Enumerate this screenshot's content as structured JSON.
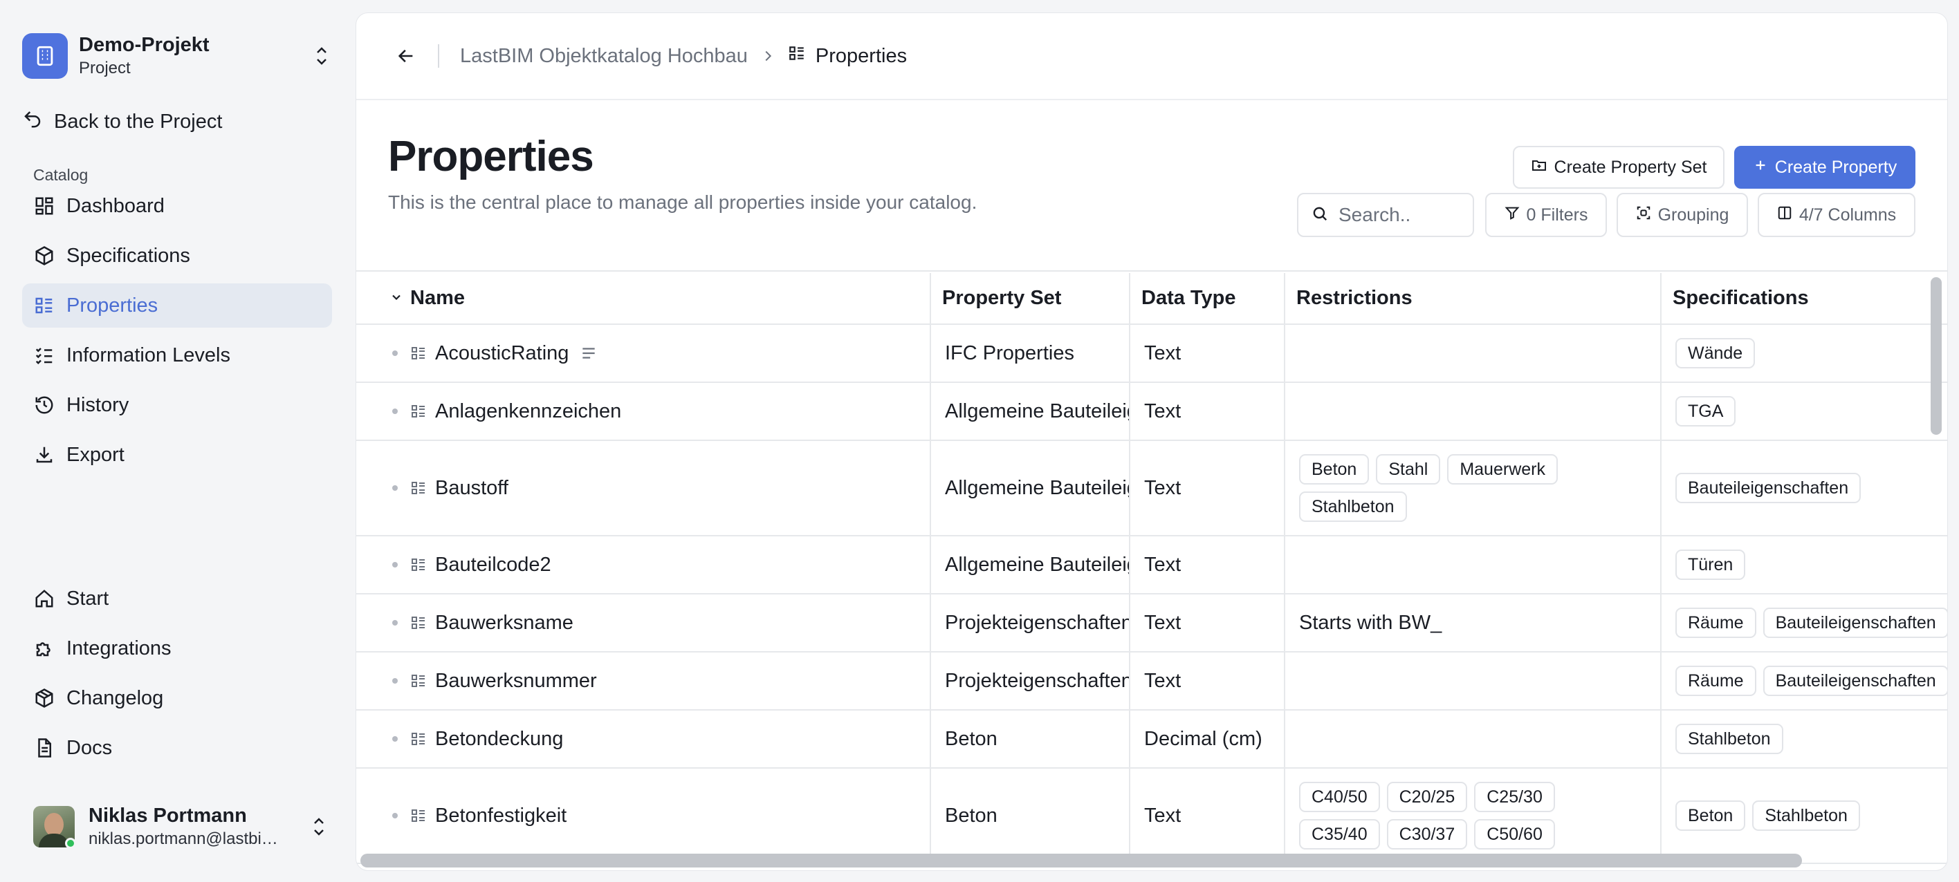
{
  "project": {
    "name": "Demo-Projekt",
    "type": "Project"
  },
  "sidebar": {
    "back_label": "Back to the Project",
    "section_label": "Catalog",
    "items": [
      {
        "label": "Dashboard",
        "icon": "dashboard-icon"
      },
      {
        "label": "Specifications",
        "icon": "box-icon"
      },
      {
        "label": "Properties",
        "icon": "list-icon",
        "active": true
      },
      {
        "label": "Information Levels",
        "icon": "checklist-icon"
      },
      {
        "label": "History",
        "icon": "history-icon"
      },
      {
        "label": "Export",
        "icon": "download-icon"
      }
    ],
    "bottom_items": [
      {
        "label": "Start",
        "icon": "home-icon"
      },
      {
        "label": "Integrations",
        "icon": "puzzle-icon"
      },
      {
        "label": "Changelog",
        "icon": "package-icon"
      },
      {
        "label": "Docs",
        "icon": "document-icon"
      }
    ]
  },
  "user": {
    "name": "Niklas Portmann",
    "email": "niklas.portmann@lastbi…"
  },
  "breadcrumb": {
    "parent": "LastBIM Objektkatalog Hochbau",
    "current": "Properties"
  },
  "page": {
    "title": "Properties",
    "subtitle": "This is the central place to manage all properties inside your catalog."
  },
  "actions": {
    "create_set": "Create Property Set",
    "create_property": "Create Property",
    "search_placeholder": "Search..",
    "filters": "0 Filters",
    "grouping": "Grouping",
    "columns": "4/7 Columns"
  },
  "table": {
    "headers": [
      "Name",
      "Property Set",
      "Data Type",
      "Restrictions",
      "Specifications"
    ],
    "rows": [
      {
        "name": "AcousticRating",
        "has_description": true,
        "set": "IFC Properties",
        "type": "Text",
        "restriction_text": "",
        "restrictions": [],
        "specs": [
          "Wände"
        ]
      },
      {
        "name": "Anlagenkennzeichen",
        "set": "Allgemeine Bauteileigenschaften",
        "type": "Text",
        "restriction_text": "",
        "restrictions": [],
        "specs": [
          "TGA"
        ]
      },
      {
        "name": "Baustoff",
        "set": "Allgemeine Bauteileigenschaften",
        "type": "Text",
        "restriction_text": "",
        "restrictions": [
          "Beton",
          "Stahl",
          "Mauerwerk",
          "Stahlbeton"
        ],
        "specs": [
          "Bauteileigenschaften"
        ]
      },
      {
        "name": "Bauteilcode2",
        "set": "Allgemeine Bauteileigenschaften",
        "type": "Text",
        "restriction_text": "",
        "restrictions": [],
        "specs": [
          "Türen"
        ]
      },
      {
        "name": "Bauwerksname",
        "set": "Projekteigenschaften",
        "type": "Text",
        "restriction_text": "Starts with BW_",
        "restrictions": [],
        "specs": [
          "Räume",
          "Bauteileigenschaften"
        ]
      },
      {
        "name": "Bauwerksnummer",
        "set": "Projekteigenschaften",
        "type": "Text",
        "restriction_text": "",
        "restrictions": [],
        "specs": [
          "Räume",
          "Bauteileigenschaften"
        ]
      },
      {
        "name": "Betondeckung",
        "set": "Beton",
        "type": "Decimal (cm)",
        "restriction_text": "",
        "restrictions": [],
        "specs": [
          "Stahlbeton"
        ]
      },
      {
        "name": "Betonfestigkeit",
        "set": "Beton",
        "type": "Text",
        "restriction_text": "",
        "restrictions": [
          "C40/50",
          "C20/25",
          "C25/30",
          "C35/40",
          "C30/37",
          "C50/60"
        ],
        "specs": [
          "Beton",
          "Stahlbeton"
        ]
      }
    ]
  },
  "colors": {
    "accent": "#4c72dc",
    "active_nav_bg": "#e4e9f1",
    "sidebar_bg": "#f4f5f7"
  }
}
